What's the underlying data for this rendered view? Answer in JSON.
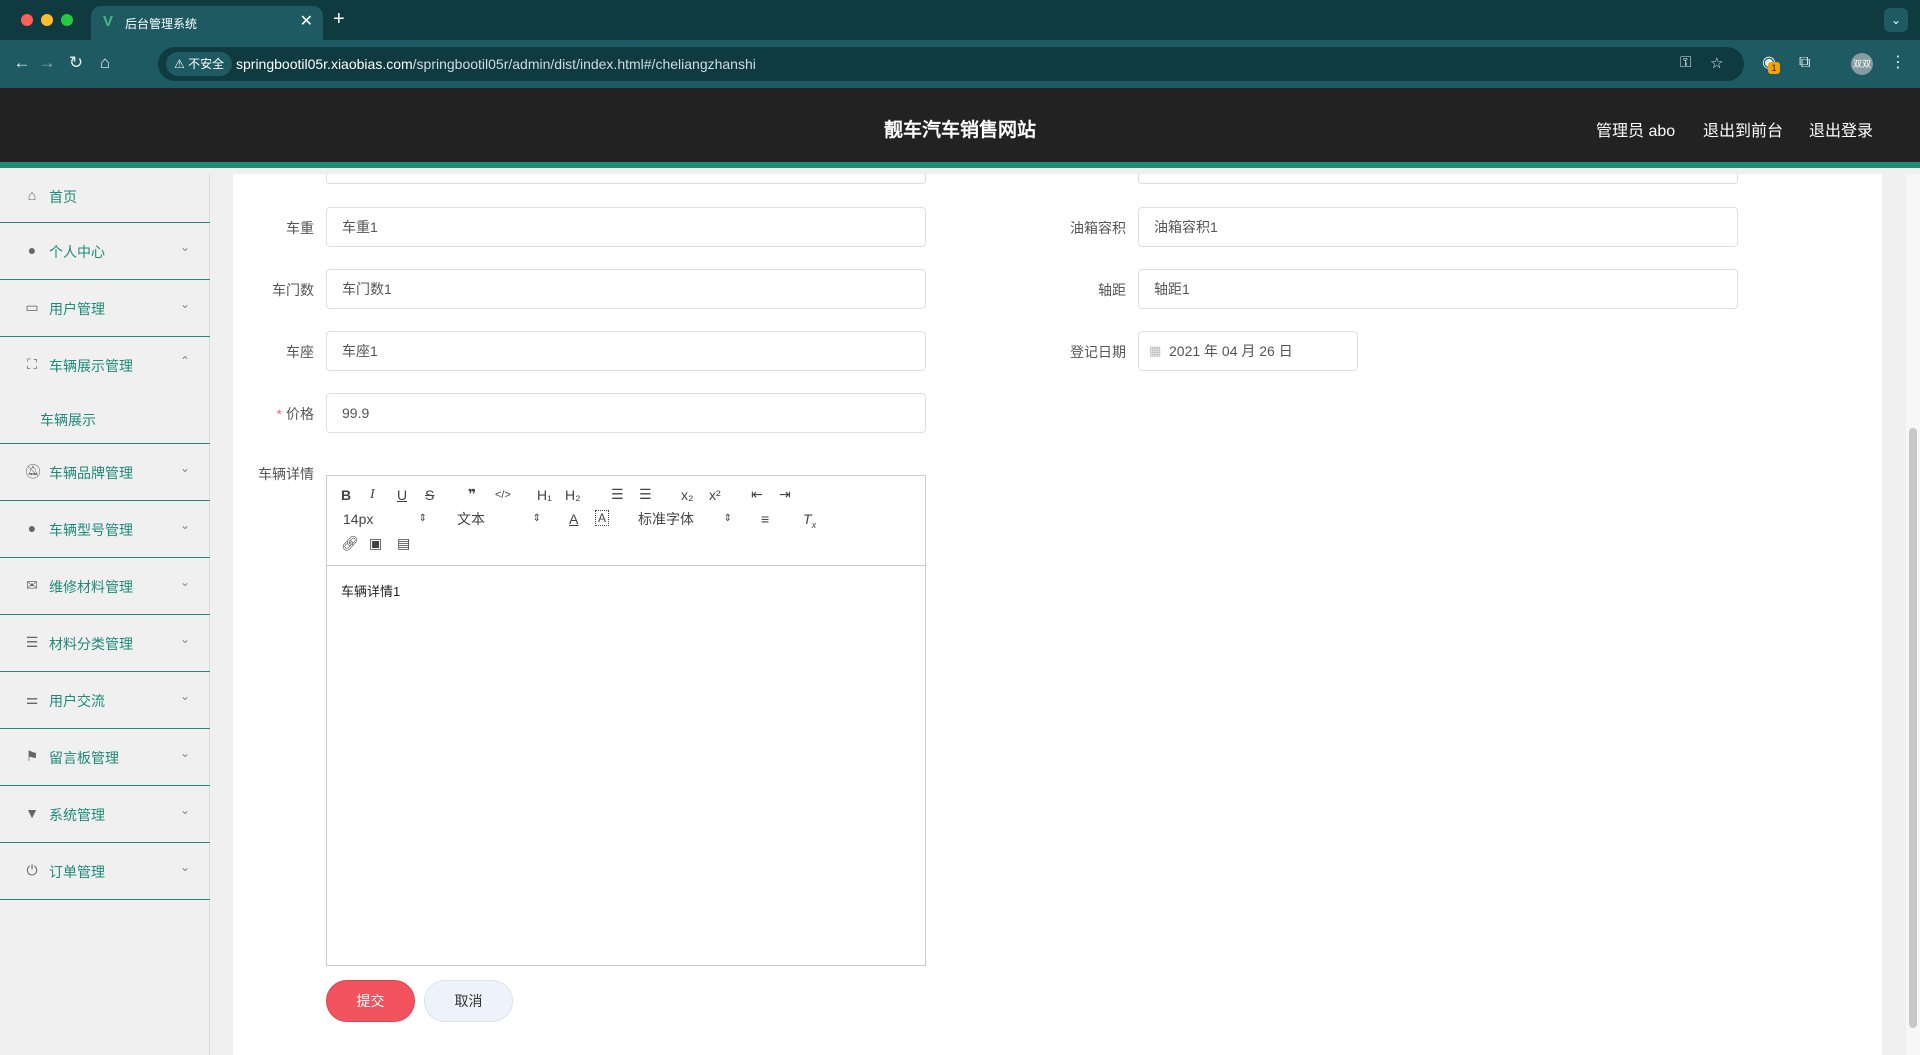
{
  "browser": {
    "tab_title": "后台管理系统",
    "tab_close": "✕",
    "new_tab": "+",
    "insecure_label": "不安全",
    "url_host": "springbootil05r.xiaobias.com",
    "url_path": "/springbootil05r/admin/dist/index.html#/cheliangzhanshi",
    "extension_badge": "1",
    "profile_text": "双双"
  },
  "header": {
    "site_title": "靓车汽车销售网站",
    "admin_label": "管理员 abo",
    "back_to_front": "退出到前台",
    "logout": "退出登录"
  },
  "sidebar": {
    "items": [
      {
        "label": "首页",
        "icon": "home-icon"
      },
      {
        "label": "个人中心",
        "icon": "user-icon"
      },
      {
        "label": "用户管理",
        "icon": "chat-icon"
      },
      {
        "label": "车辆展示管理",
        "icon": "fullscreen-icon",
        "expanded": true
      },
      {
        "label": "车辆品牌管理",
        "icon": "bell-off-icon"
      },
      {
        "label": "车辆型号管理",
        "icon": "location-icon"
      },
      {
        "label": "维修材料管理",
        "icon": "mail-icon"
      },
      {
        "label": "材料分类管理",
        "icon": "list-icon"
      },
      {
        "label": "用户交流",
        "icon": "sliders-icon"
      },
      {
        "label": "留言板管理",
        "icon": "flag-icon"
      },
      {
        "label": "系统管理",
        "icon": "brush-icon"
      },
      {
        "label": "订单管理",
        "icon": "power-icon"
      }
    ],
    "submenu_label": "车辆展示"
  },
  "form": {
    "weight_label": "车重",
    "weight_value": "车重1",
    "tank_label": "油箱容积",
    "tank_value": "油箱容积1",
    "doors_label": "车门数",
    "doors_value": "车门数1",
    "wheelbase_label": "轴距",
    "wheelbase_value": "轴距1",
    "seats_label": "车座",
    "seats_value": "车座1",
    "date_label": "登记日期",
    "date_value": "2021 年 04 月 26 日",
    "price_required": "*",
    "price_label": "价格",
    "price_value": "99.9",
    "details_label": "车辆详情",
    "details_content": "车辆详情1",
    "submit_label": "提交",
    "cancel_label": "取消"
  },
  "editor_toolbar": {
    "font_size": "14px",
    "heading": "文本",
    "font_family": "标准字体",
    "h1": "H₁",
    "h2": "H₂",
    "sub": "x₂",
    "sup": "x²"
  },
  "colors": {
    "accent": "#1e8a78",
    "header_bg": "#222222",
    "submit_bg": "#f1545f",
    "browser_bg": "#1d5a61"
  }
}
